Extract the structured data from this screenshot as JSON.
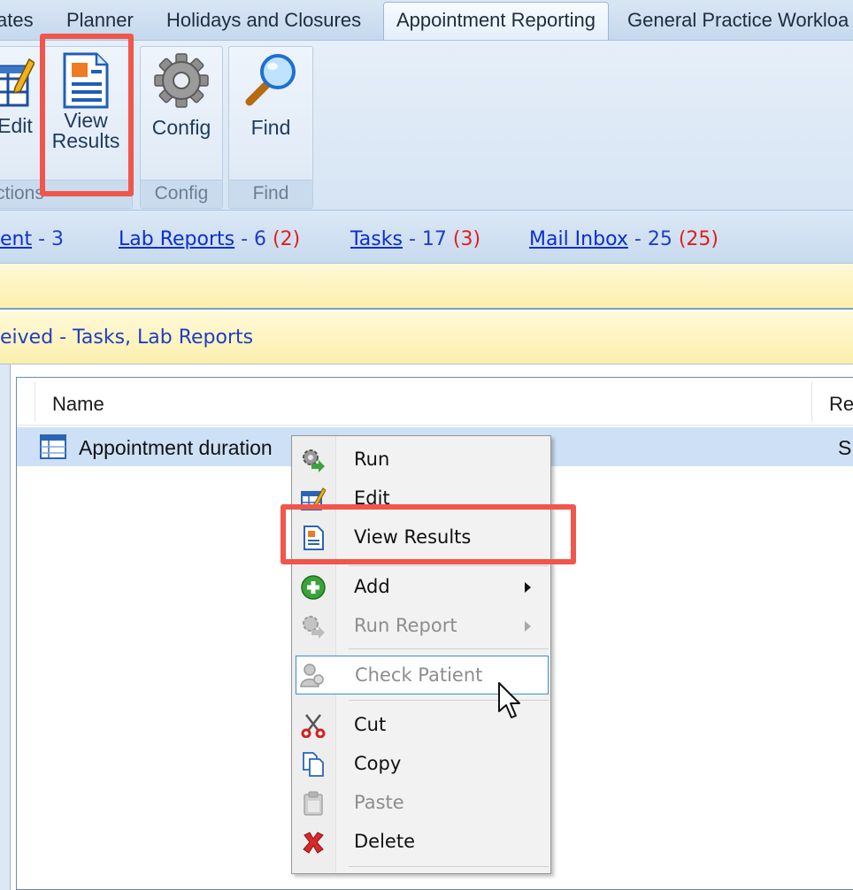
{
  "tabs": [
    {
      "label": "ates",
      "active": false
    },
    {
      "label": "Planner",
      "active": false
    },
    {
      "label": "Holidays and Closures",
      "active": false
    },
    {
      "label": "Appointment Reporting",
      "active": true
    },
    {
      "label": "General Practice Workloa",
      "active": false
    }
  ],
  "ribbon": {
    "edit_label": "Edit",
    "view_results_label": "View\nResults",
    "actions_group_label": "ctions",
    "config_label": "Config",
    "config_group_label": "Config",
    "find_label": "Find",
    "find_group_label": "Find"
  },
  "quick_links": [
    {
      "name": "ent",
      "count": "- 3",
      "unread": ""
    },
    {
      "name": "Lab Reports",
      "count": "- 6",
      "unread": "(2)"
    },
    {
      "name": "Tasks",
      "count": "- 17",
      "unread": "(3)"
    },
    {
      "name": "Mail Inbox",
      "count": "- 25",
      "unread": "(25)"
    }
  ],
  "notice_bar": "eived - Tasks, Lab Reports",
  "list": {
    "columns": [
      "Name",
      "Re"
    ],
    "rows": [
      {
        "name": "Appointment duration",
        "col2": "S"
      }
    ]
  },
  "context_menu": {
    "items": [
      {
        "label": "Run",
        "icon": "run-icon",
        "enabled": true
      },
      {
        "label": "Edit",
        "icon": "edit-icon",
        "enabled": true
      },
      {
        "label": "View Results",
        "icon": "view-results-icon",
        "enabled": true
      },
      {
        "label": "Add",
        "icon": "add-icon",
        "enabled": true,
        "submenu": true
      },
      {
        "label": "Run Report",
        "icon": "run-report-icon",
        "enabled": false,
        "submenu": true
      },
      {
        "label": "Check Patient",
        "icon": "check-patient-icon",
        "enabled": false
      },
      {
        "label": "Cut",
        "icon": "cut-icon",
        "enabled": true
      },
      {
        "label": "Copy",
        "icon": "copy-icon",
        "enabled": true
      },
      {
        "label": "Paste",
        "icon": "paste-icon",
        "enabled": false
      },
      {
        "label": "Delete",
        "icon": "delete-icon",
        "enabled": true
      }
    ]
  },
  "colors": {
    "highlight": "#f0564b",
    "link": "#0a2fd0",
    "unread": "#e01e1e",
    "selection": "#cde0f6"
  }
}
